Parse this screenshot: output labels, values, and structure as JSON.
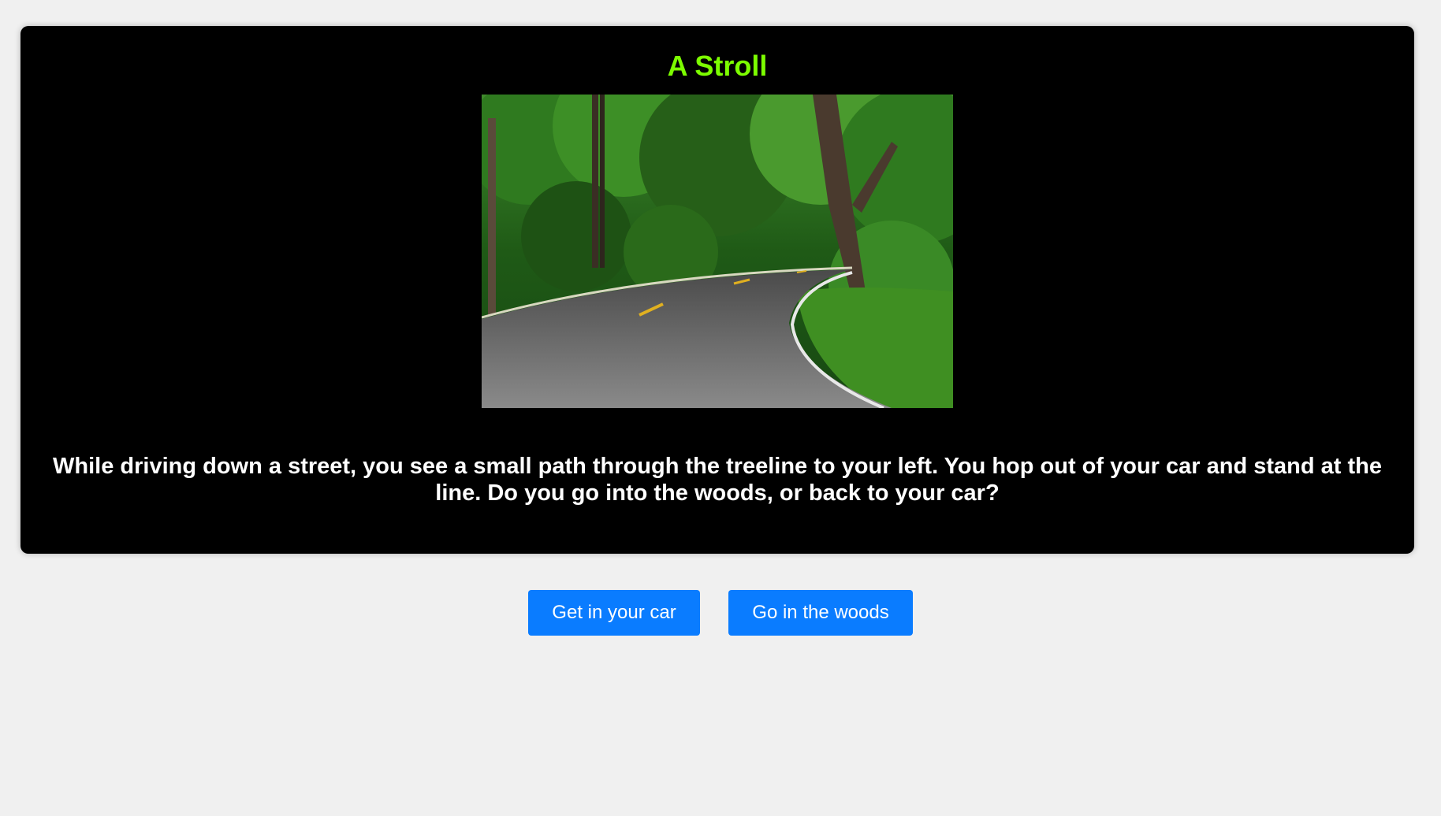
{
  "story": {
    "title": "A Stroll",
    "text": "While driving down a street, you see a small path through the treeline to your left. You hop out of your car and stand at the line. Do you go into the woods, or back to your car?"
  },
  "image": {
    "icon": "forest-road-photo"
  },
  "choices": [
    {
      "label": "Get in your car"
    },
    {
      "label": "Go in the woods"
    }
  ],
  "colors": {
    "title": "#7cfc00",
    "card_background": "#000000",
    "page_background": "#f0f0f0",
    "button": "#0a7cff"
  }
}
